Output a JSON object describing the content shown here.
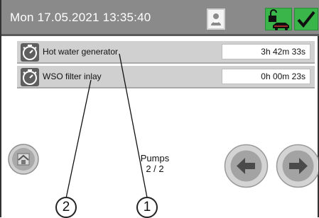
{
  "header": {
    "datetime": "Mon 17.05.2021  13:35:40",
    "user_icon": "user-icon",
    "lock_icon": "unlock-car-icon",
    "confirm_icon": "checkmark-icon"
  },
  "timers": [
    {
      "icon": "stopwatch-icon",
      "label": "Hot water generator",
      "value": "3h 42m 33s"
    },
    {
      "icon": "stopwatch-icon",
      "label": "WSO filter inlay",
      "value": "0h 00m 23s"
    }
  ],
  "footer": {
    "home_icon": "home-icon",
    "page_title": "Pumps",
    "page_number": "2 / 2",
    "prev_icon": "arrow-left-icon",
    "next_icon": "arrow-right-icon"
  },
  "callouts": [
    "2",
    "1"
  ],
  "colors": {
    "header_bg": "#8a8a8a",
    "accent_green": "#39b54a",
    "row_bg": "#d0d0d0"
  }
}
